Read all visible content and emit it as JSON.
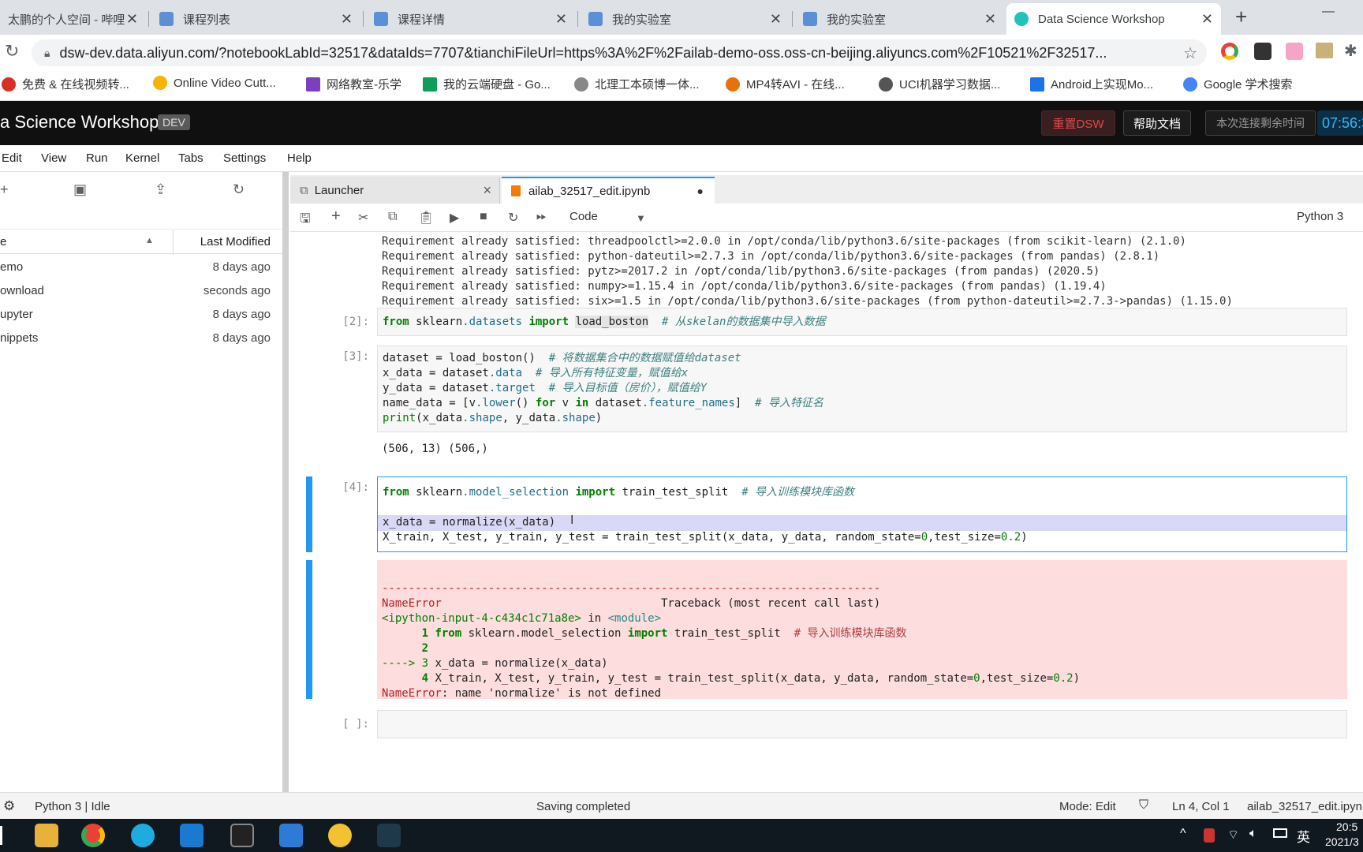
{
  "browser": {
    "tabs": [
      {
        "title": "太鹏的个人空间 - 哔哩",
        "active": false
      },
      {
        "title": "课程列表",
        "active": false
      },
      {
        "title": "课程详情",
        "active": false
      },
      {
        "title": "我的实验室",
        "active": false
      },
      {
        "title": "我的实验室",
        "active": false
      },
      {
        "title": "Data Science Workshop",
        "active": true
      }
    ],
    "new_tab": "+",
    "minimize": "—",
    "url": "dsw-dev.data.aliyun.com/?notebookLabId=32517&dataIds=7707&tianchiFileUrl=https%3A%2F%2Failab-demo-oss.oss-cn-beijing.aliyuncs.com%2F10521%2F32517..."
  },
  "bookmarks": [
    {
      "label": "免费 & 在线视频转...",
      "color": "#d93025"
    },
    {
      "label": "Online Video Cutt...",
      "color": "#f4b400"
    },
    {
      "label": "网络教室-乐学",
      "color": "#7b3fbf"
    },
    {
      "label": "我的云端硬盘 - Go...",
      "color": "#0f9d58"
    },
    {
      "label": "北理工本硕博一体...",
      "color": "#888888"
    },
    {
      "label": "MP4转AVI - 在线...",
      "color": "#e8710a"
    },
    {
      "label": "UCI机器学习数据...",
      "color": "#555555"
    },
    {
      "label": "Android上实现Mo...",
      "color": "#1a73e8"
    },
    {
      "label": "Google 学术搜索",
      "color": "#4285f4"
    }
  ],
  "dsw": {
    "title": "a Science Workshop",
    "badge": "DEV",
    "reset_btn": "重置DSW",
    "help_btn": "帮助文档",
    "remaining_label": "本次连接剩余时间",
    "timer": "07:56:3"
  },
  "menu": [
    "Edit",
    "View",
    "Run",
    "Kernel",
    "Tabs",
    "Settings",
    "Help"
  ],
  "filebrowser": {
    "col_name": "e",
    "col_modified": "Last Modified",
    "rows": [
      {
        "name": "emo",
        "modified": "8 days ago"
      },
      {
        "name": "ownload",
        "modified": "seconds ago"
      },
      {
        "name": "upyter",
        "modified": "8 days ago"
      },
      {
        "name": "nippets",
        "modified": "8 days ago"
      }
    ]
  },
  "notebook": {
    "tabs": [
      {
        "label": "Launcher",
        "close": "×"
      },
      {
        "label": "ailab_32517_edit.ipynb",
        "close": "●"
      }
    ],
    "cell_type": "Code",
    "kernel": "Python 3",
    "output0": [
      "Requirement already satisfied: python-dateutil>=2.7.3 in /opt/conda/lib/python3.6/site-packages (from pandas) (2.8.1)",
      "Requirement already satisfied: pytz>=2017.2 in /opt/conda/lib/python3.6/site-packages (from pandas) (2020.5)",
      "Requirement already satisfied: numpy>=1.15.4 in /opt/conda/lib/python3.6/site-packages (from pandas) (1.19.4)",
      "Requirement already satisfied: six>=1.5 in /opt/conda/lib/python3.6/site-packages (from python-dateutil>=2.7.3->pandas) (1.15.0)"
    ],
    "cells": [
      {
        "prompt": "[2]:",
        "code": "from sklearn.datasets import load_boston  # 从skelan的数据集中导入数据"
      },
      {
        "prompt": "[3]:",
        "code": "dataset = load_boston()  # 将数据集合中的数据赋值给dataset\nx_data = dataset.data  # 导入所有特征变量，赋值给x\ny_data = dataset.target  # 导入目标值（房价），赋值给Y\nname_data = [v.lower() for v in dataset.feature_names]  # 导入特征名\nprint(x_data.shape, y_data.shape)",
        "output": "(506, 13) (506,)"
      },
      {
        "prompt": "[4]:",
        "code": "from sklearn.model_selection import train_test_split  # 导入训练模块库函数\n\nx_data = normalize(x_data)\nX_train, X_test, y_train, y_test = train_test_split(x_data, y_data, random_state=0,test_size=0.2)"
      },
      {
        "prompt": "[ ]:",
        "code": ""
      }
    ],
    "error": [
      "---------------------------------------------------------------------------",
      "NameError                                 Traceback (most recent call last)",
      "<ipython-input-4-c434c1c71a8e> in <module>",
      "      1 from sklearn.model_selection import train_test_split  # 导入训练模块库函数",
      "      2",
      "----> 3 x_data = normalize(x_data)",
      "      4 X_train, X_test, y_train, y_test = train_test_split(x_data, y_data, random_state=0,test_size=0.2)",
      "",
      "NameError: name 'normalize' is not defined"
    ]
  },
  "status": {
    "kernel": "Python 3 | Idle",
    "saving": "Saving completed",
    "mode": "Mode: Edit",
    "position": "Ln 4, Col 1",
    "file": "ailab_32517_edit.ipyn"
  },
  "taskbar": {
    "ime": "英",
    "time": "20:5",
    "date": "2021/3"
  }
}
